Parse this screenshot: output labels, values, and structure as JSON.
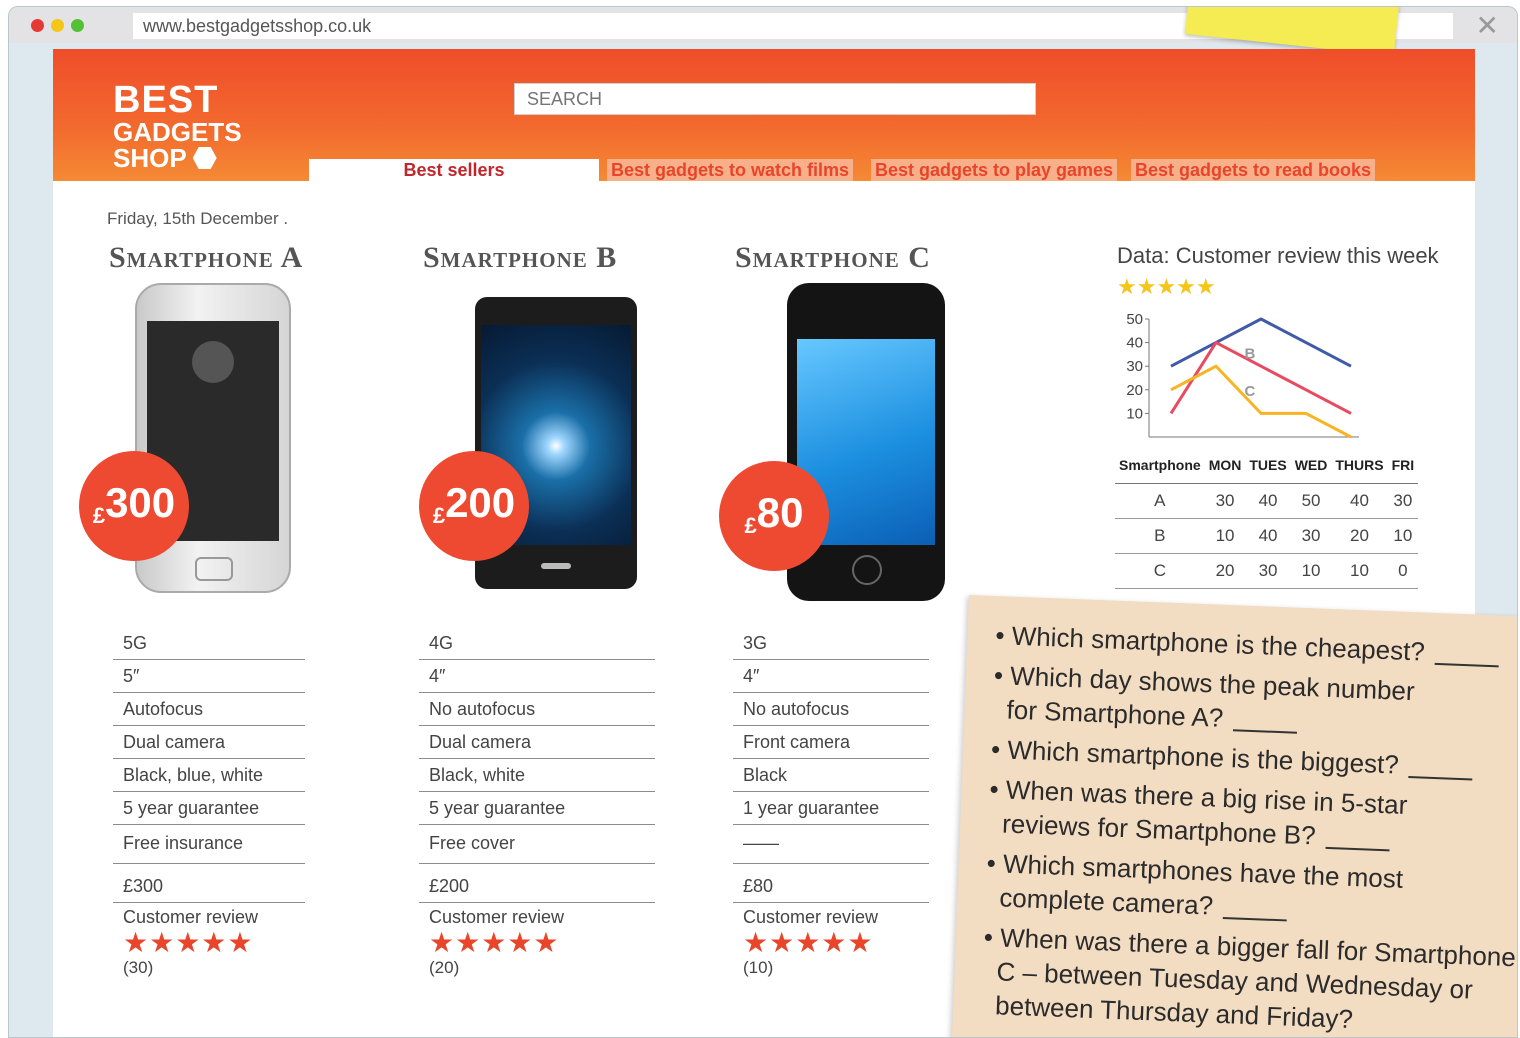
{
  "browser": {
    "url": "www.bestgadgetsshop.co.uk",
    "close_label": "✕"
  },
  "header": {
    "logo": {
      "line1": "BEST",
      "line2": "GADGETS",
      "line3": "SHOP"
    },
    "search_placeholder": "SEARCH",
    "nav": {
      "active": "Best sellers",
      "tabs": [
        "Best gadgets to watch films",
        "Best gadgets to play games",
        "Best gadgets to read books"
      ]
    }
  },
  "date": "Friday, 15th December .",
  "products": [
    {
      "name": "Smartphone A",
      "badge_currency": "£",
      "badge_value": "300",
      "specs": [
        "5G",
        "5″",
        "Autofocus",
        "Dual camera",
        "Black, blue, white",
        "5 year guarantee",
        "Free insurance"
      ],
      "price": "£300",
      "review_label": "Customer review",
      "stars": 5,
      "count": "(30)"
    },
    {
      "name": "Smartphone B",
      "badge_currency": "£",
      "badge_value": "200",
      "specs": [
        "4G",
        "4″",
        "No autofocus",
        "Dual camera",
        "Black, white",
        "5 year guarantee",
        "Free cover"
      ],
      "price": "£200",
      "review_label": "Customer review",
      "stars": 5,
      "count": "(20)"
    },
    {
      "name": "Smartphone C",
      "badge_currency": "£",
      "badge_value": "80",
      "specs": [
        "3G",
        "4″",
        "No autofocus",
        "Front camera",
        "Black",
        "1 year guarantee",
        "——"
      ],
      "price": "£80",
      "review_label": "Customer review",
      "stars": 5,
      "count": "(10)"
    }
  ],
  "stars_glyph": "★★★★★",
  "chart_data": {
    "type": "line",
    "title": "Data: Customer review this week",
    "categories": [
      "MON",
      "TUES",
      "WED",
      "THURS",
      "FRI"
    ],
    "series": [
      {
        "name": "A",
        "values": [
          30,
          40,
          50,
          40,
          30
        ],
        "color": "#3f5aa6"
      },
      {
        "name": "B",
        "values": [
          10,
          40,
          30,
          20,
          10
        ],
        "color": "#e84a5f"
      },
      {
        "name": "C",
        "values": [
          20,
          30,
          10,
          10,
          0
        ],
        "color": "#f8b422"
      }
    ],
    "yticks": [
      10,
      20,
      30,
      40,
      50
    ],
    "ylim": [
      0,
      50
    ]
  },
  "table": {
    "headers": [
      "Smartphone",
      "MON",
      "TUES",
      "WED",
      "THURS",
      "FRI"
    ],
    "rows": [
      [
        "A",
        "30",
        "40",
        "50",
        "40",
        "30"
      ],
      [
        "B",
        "10",
        "40",
        "30",
        "20",
        "10"
      ],
      [
        "C",
        "20",
        "30",
        "10",
        "10",
        "0"
      ]
    ]
  },
  "questions": [
    "Which smartphone is the cheapest?",
    "Which day shows the peak number",
    "for Smartphone A?",
    "Which smartphone is the biggest?",
    "When was there a big rise in 5-star",
    "reviews for Smartphone B?",
    "Which smartphones have the most",
    "complete camera?",
    "When was there a bigger fall for Smartphone",
    "C – between Tuesday and Wednesday or",
    "between Thursday and Friday?"
  ]
}
